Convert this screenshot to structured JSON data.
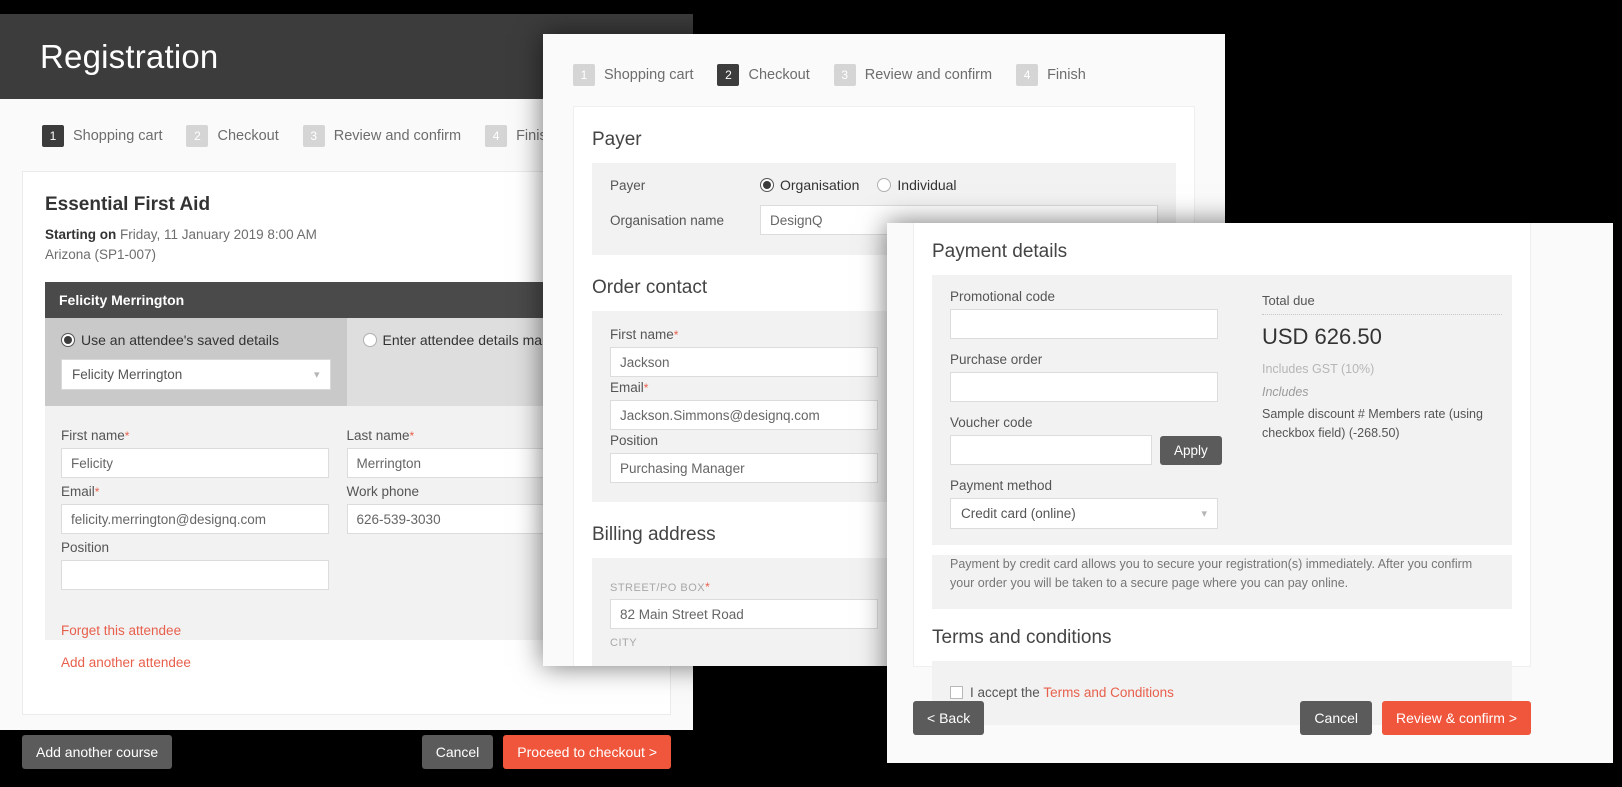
{
  "panel1": {
    "header_title": "Registration",
    "steps": [
      {
        "num": "1",
        "label": "Shopping cart",
        "active": true
      },
      {
        "num": "2",
        "label": "Checkout",
        "active": false
      },
      {
        "num": "3",
        "label": "Review and confirm",
        "active": false
      },
      {
        "num": "4",
        "label": "Finish",
        "active": false
      }
    ],
    "course": {
      "title": "Essential First Aid",
      "starting_label": "Starting on",
      "starting_value": "Friday, 11 January 2019 8:00 AM",
      "location": "Arizona (SP1-007)"
    },
    "attendee": {
      "bar_title": "Felicity Merrington",
      "option_saved": "Use an attendee's saved details",
      "option_manual": "Enter attendee details manu",
      "saved_select_value": "Felicity Merrington",
      "fields": [
        {
          "label": "First name",
          "required": true,
          "value": "Felicity"
        },
        {
          "label": "Last name",
          "required": true,
          "value": "Merrington"
        },
        {
          "label": "Email",
          "required": true,
          "value": "felicity.merrington@designq.com"
        },
        {
          "label": "Work phone",
          "required": false,
          "value": "626-539-3030"
        },
        {
          "label": "Position",
          "required": false,
          "value": ""
        }
      ],
      "forget_link": "Forget this attendee",
      "add_attendee_link": "Add another attendee"
    },
    "buttons": {
      "add_course": "Add another course",
      "cancel": "Cancel",
      "proceed": "Proceed to checkout >"
    }
  },
  "panel2": {
    "steps": [
      {
        "num": "1",
        "label": "Shopping cart",
        "active": false
      },
      {
        "num": "2",
        "label": "Checkout",
        "active": true
      },
      {
        "num": "3",
        "label": "Review and confirm",
        "active": false
      },
      {
        "num": "4",
        "label": "Finish",
        "active": false
      }
    ],
    "payer": {
      "section_title": "Payer",
      "payer_label": "Payer",
      "option_organisation": "Organisation",
      "option_individual": "Individual",
      "org_name_label": "Organisation name",
      "org_name_value": "DesignQ"
    },
    "order_contact": {
      "section_title": "Order contact",
      "fields": [
        {
          "label": "First name",
          "required": true,
          "value": "Jackson"
        },
        {
          "label": "Email",
          "required": true,
          "value": "Jackson.Simmons@designq.com"
        },
        {
          "label": "Position",
          "required": false,
          "value": "Purchasing Manager"
        }
      ]
    },
    "billing_address": {
      "section_title": "Billing address",
      "street_label": "STREET/PO BOX",
      "street_required": true,
      "street_value": "82 Main Street Road",
      "city_label": "CITY"
    }
  },
  "panel3": {
    "payment": {
      "section_title": "Payment details",
      "promo_label": "Promotional code",
      "promo_value": "",
      "po_label": "Purchase order",
      "po_value": "",
      "voucher_label": "Voucher code",
      "voucher_value": "",
      "apply_button": "Apply",
      "method_label": "Payment method",
      "method_value": "Credit card (online)",
      "note": "Payment by credit card allows you to secure your registration(s) immediately. After you confirm your order you will be taken to a secure page where you can pay online."
    },
    "summary": {
      "total_due_label": "Total due",
      "total_due_amount": "USD 626.50",
      "gst_note": "Includes GST (10%)",
      "includes_label": "Includes",
      "discount_line": "Sample discount # Members rate (using checkbox field) (-268.50)"
    },
    "terms": {
      "section_title": "Terms and conditions",
      "accept_prefix": "I accept the ",
      "accept_link": "Terms and Conditions"
    },
    "buttons": {
      "back": "< Back",
      "cancel": "Cancel",
      "review": "Review & confirm >"
    }
  },
  "colors": {
    "accent_orange": "#f0563c",
    "dark_header": "#3c3c3c",
    "dark_button": "#5b5b5b",
    "link_red": "#e8604c"
  }
}
